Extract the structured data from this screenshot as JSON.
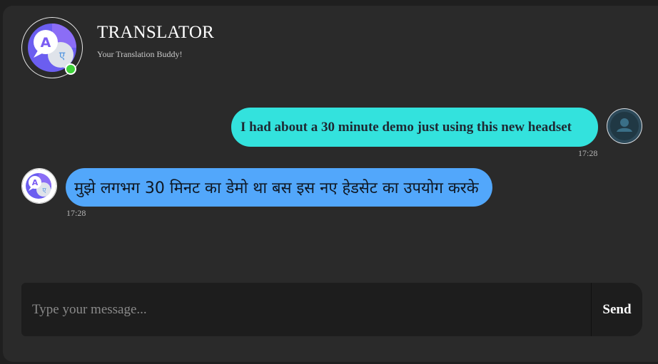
{
  "header": {
    "title": "TRANSLATOR",
    "subtitle": "Your Translation Buddy!",
    "avatar_icon": "translate-bubbles-icon",
    "status": "online"
  },
  "messages": [
    {
      "direction": "outgoing",
      "text": "I had about a 30 minute demo just using this new headset",
      "time": "17:28",
      "avatar_icon": "user-icon"
    },
    {
      "direction": "incoming",
      "text": "मुझे लगभग 30 मिनट का डेमो था बस इस नए हेडसेट का उपयोग करके",
      "time": "17:28",
      "avatar_icon": "translate-bubbles-icon"
    }
  ],
  "composer": {
    "placeholder": "Type your message...",
    "value": "",
    "send_label": "Send"
  },
  "colors": {
    "background": "#2a2a2a",
    "outgoing_bubble": "#33e2dd",
    "incoming_bubble": "#52a7fb",
    "composer": "#1d1d1d",
    "online": "#3fd13a"
  }
}
